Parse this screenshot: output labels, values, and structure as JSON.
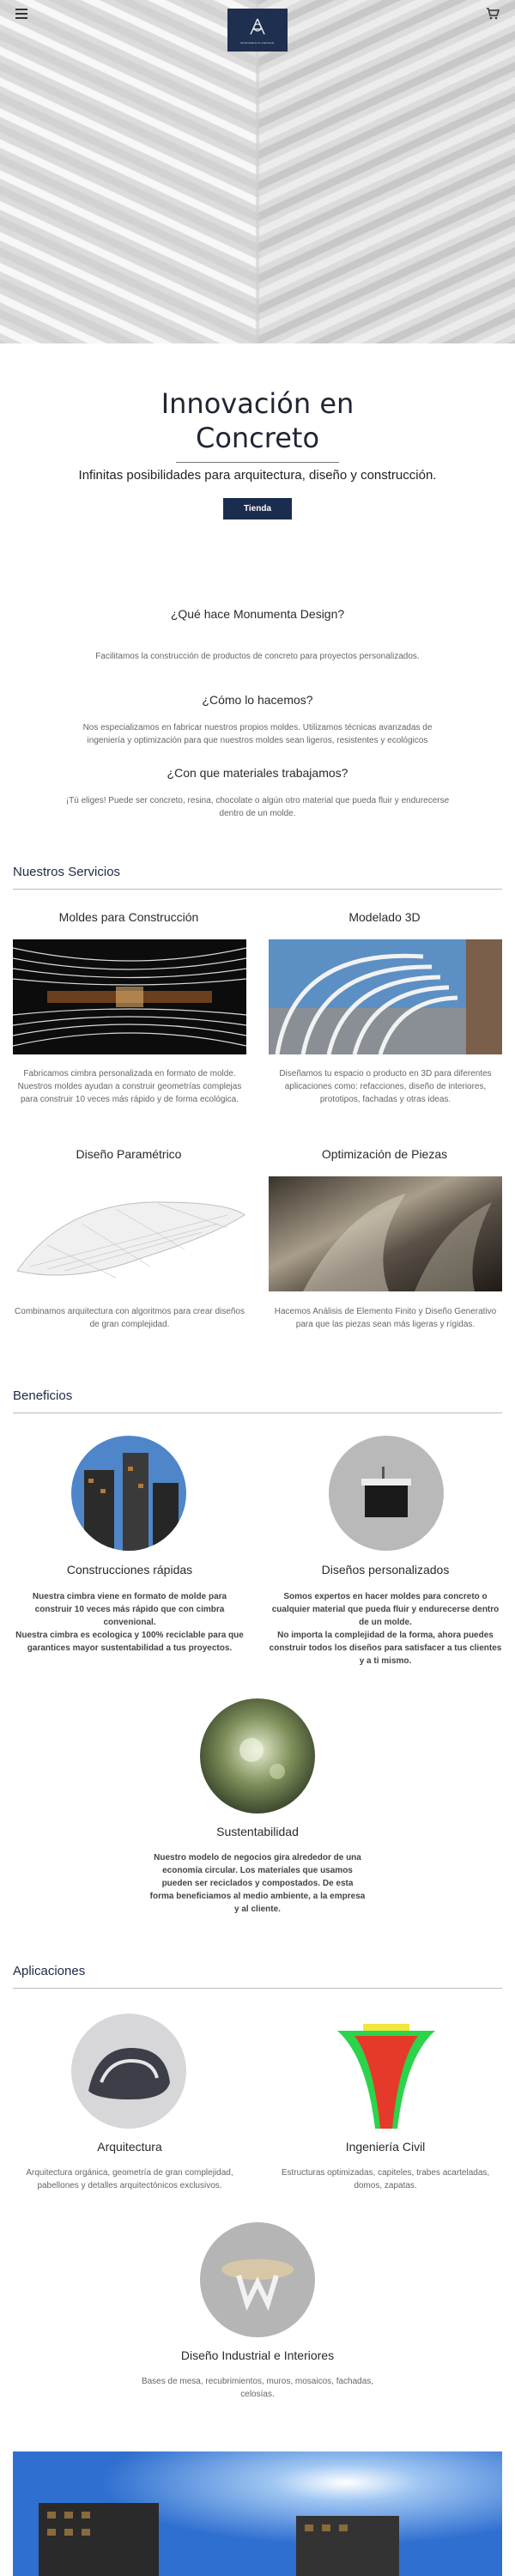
{
  "header": {
    "menu_icon": "hamburger-menu-icon",
    "cart_icon": "shopping-cart-icon",
    "logo_text": "MONUMENTA DESIGN"
  },
  "hero": {
    "title_line1": "Innovación en",
    "title_line2": "Concreto",
    "subtitle": "Infinitas posibilidades para arquitectura, diseño y construcción.",
    "cta_label": "Tienda"
  },
  "about": [
    {
      "question": "¿Qué hace Monumenta Design?",
      "answer": "Facilitamos la construcción de productos de concreto para proyectos personalizados."
    },
    {
      "question": "¿Cómo lo hacemos?",
      "answer": "Nos especializamos en fabricar nuestros propios moldes. Utilizamos técnicas avanzadas de ingeniería y optimización para que nuestros moldes sean ligeros, resistentes y ecológicos"
    },
    {
      "question": "¿Con que materiales trabajamos?",
      "answer": "¡Tú eliges! Puede ser concreto, resina, chocolate o algún otro material que pueda fluir y endurecerse dentro de un molde."
    }
  ],
  "services": {
    "heading": "Nuestros Servicios",
    "items": [
      {
        "title": "Moldes para Construcción",
        "text": "Fabricamos cimbra personalizada en formato de molde. Nuestros moldes ayudan a construir geometrías complejas para construir 10 veces más rápido y de forma ecológica."
      },
      {
        "title": "Modelado 3D",
        "text": "Diseñamos tu espacio o producto en 3D para diferentes aplicaciones como: refacciones, diseño de interiores, prototipos, fachadas y otras ideas."
      },
      {
        "title": "Diseño Paramétrico",
        "text": "Combinamos arquitectura con algoritmos para crear diseños de gran complejidad."
      },
      {
        "title": "Optimización de Piezas",
        "text": "Hacemos Análisis de Elemento Finito y Diseño Generativo para que las piezas sean más ligeras y rígidas."
      }
    ]
  },
  "benefits": {
    "heading": "Beneficios",
    "items": [
      {
        "title": "Construcciones rápidas",
        "text": "Nuestra cimbra viene en formato de molde para construir 10 veces más rápido que con cimbra convenional.\nNuestra cimbra es ecologica y 100% reciclable para que garantices mayor sustentabilidad a tus proyectos."
      },
      {
        "title": "Diseños personalizados",
        "text": "Somos expertos en hacer moldes para concreto o cualquier material que pueda fluir y endurecerse dentro de un molde.\nNo importa la complejidad de la forma, ahora puedes construir todos los diseños para satisfacer a tus clientes y a ti mismo."
      },
      {
        "title": "Sustentabilidad",
        "text": "Nuestro modelo de negocios gira alrededor de una economía circular.  Los materiales que usamos pueden ser reciclados y compostados. De esta forma beneficiamos al medio ambiente, a la empresa y al cliente."
      }
    ]
  },
  "applications": {
    "heading": "Aplicaciones",
    "items": [
      {
        "title": "Arquitectura",
        "text": "Arquitectura orgánica, geometría de gran complejidad, pabellones y detalles arquitectónicos exclusivos."
      },
      {
        "title": "Ingeniería Civil",
        "text": "Estructuras optimizadas, capiteles, trabes acarteladas, domos, zapatas."
      },
      {
        "title": "Diseño Industrial e Interiores",
        "text": "Bases de mesa, recubrimientos, muros, mosaicos, fachadas, celosías."
      }
    ]
  },
  "colors": {
    "brand_navy": "#1b2d4f",
    "heading_text": "#1e2a44",
    "body_text": "#666666"
  }
}
